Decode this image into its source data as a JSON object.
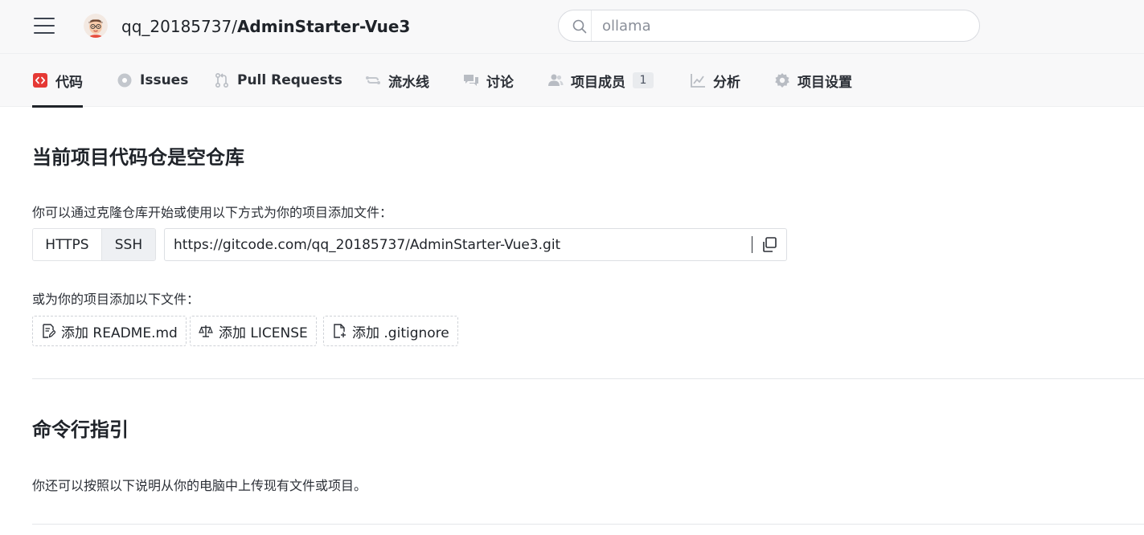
{
  "header": {
    "owner": "qq_20185737/",
    "repo_name": "AdminStarter-Vue3",
    "search_value": "ollama"
  },
  "tabs": [
    {
      "label": "代码",
      "icon": "code-icon",
      "active": true
    },
    {
      "label": "Issues",
      "icon": "issue-icon",
      "active": false
    },
    {
      "label": "Pull Requests",
      "icon": "pull-request-icon",
      "active": false
    },
    {
      "label": "流水线",
      "icon": "pipeline-icon",
      "active": false
    },
    {
      "label": "讨论",
      "icon": "discussion-icon",
      "active": false
    },
    {
      "label": "项目成员",
      "icon": "members-icon",
      "active": false,
      "badge": "1"
    },
    {
      "label": "分析",
      "icon": "analytics-icon",
      "active": false
    },
    {
      "label": "项目设置",
      "icon": "settings-icon",
      "active": false
    }
  ],
  "empty_repo": {
    "title": "当前项目代码仓是空仓库",
    "clone_hint": "你可以通过克隆仓库开始或使用以下方式为你的项目添加文件：",
    "protocols": [
      "HTTPS",
      "SSH"
    ],
    "clone_url": "https://gitcode.com/qq_20185737/AdminStarter-Vue3.git",
    "add_files_hint": "或为你的项目添加以下文件：",
    "add_buttons": [
      {
        "label": "添加 README.md",
        "icon": "readme-edit-icon"
      },
      {
        "label": "添加 LICENSE",
        "icon": "license-scale-icon"
      },
      {
        "label": "添加 .gitignore",
        "icon": "file-add-icon"
      }
    ]
  },
  "cli_guide": {
    "title": "命令行指引",
    "description": "你还可以按照以下说明从你的电脑中上传现有文件或项目。"
  },
  "colors": {
    "active_tab_icon": "#e53935",
    "header_bg": "#f8f8f9",
    "text": "#1f2329"
  }
}
